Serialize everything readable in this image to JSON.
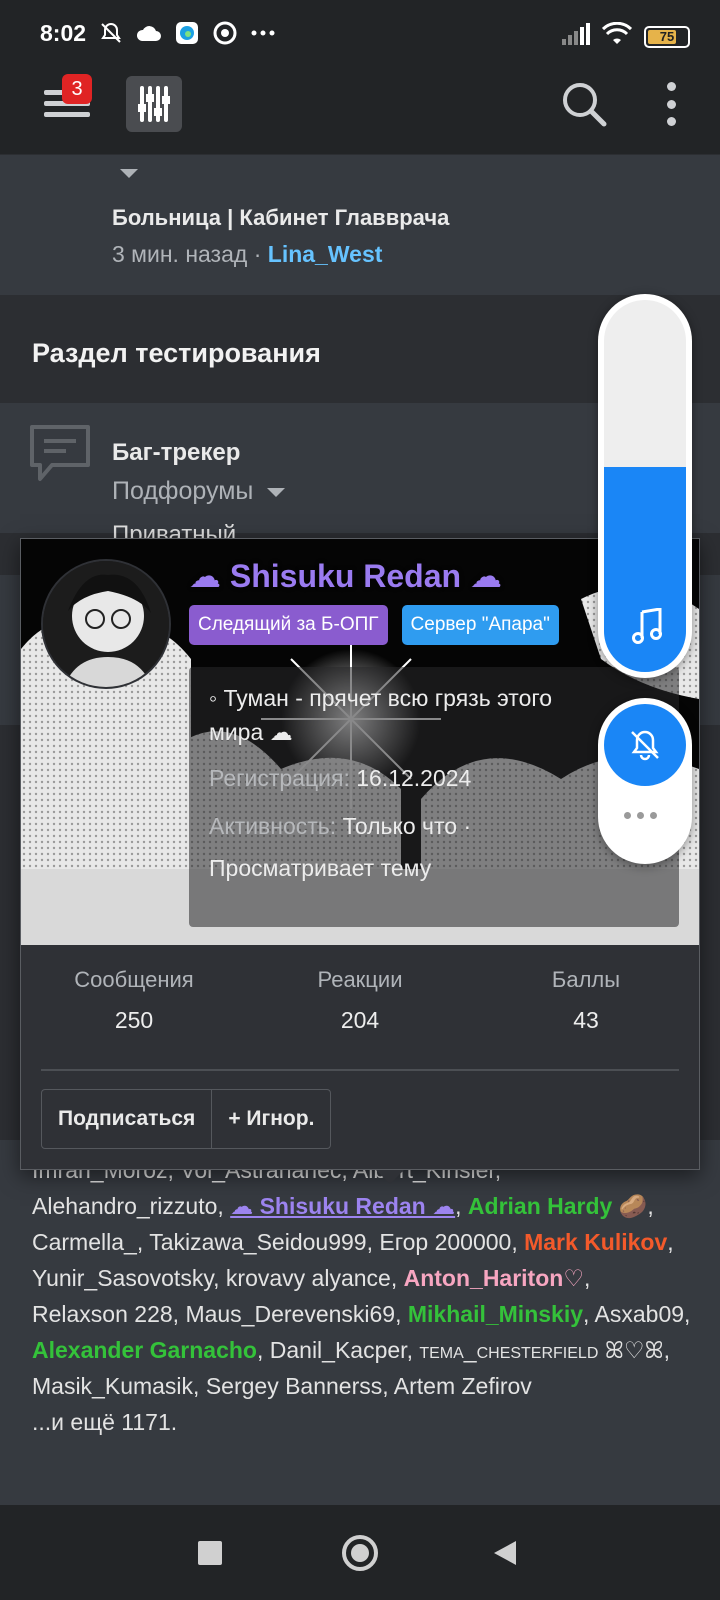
{
  "status_bar": {
    "time": "8:02",
    "battery": "75",
    "icons": [
      "bell-off-icon",
      "cloud-icon",
      "edge-browser-icon",
      "chrome-icon",
      "more-dots-icon"
    ],
    "right_icons": [
      "signal-icon",
      "wifi-icon",
      "battery-icon"
    ]
  },
  "app_bar": {
    "notification_count": "3",
    "icons": [
      "menu-icon",
      "sliders-logo-icon",
      "search-icon",
      "more-vertical-icon"
    ]
  },
  "thread": {
    "title": "Больница | Кабинет Главврача",
    "time": "3 мин. назад",
    "separator": " · ",
    "user": "Lina_West"
  },
  "section": {
    "title": "Раздел тестирования"
  },
  "forum": {
    "title": "Баг-трекер",
    "subforums_label": "Подфорумы",
    "private_label": "Приватный"
  },
  "profile_card": {
    "name": "☁ Shisuku Redan ☁",
    "badges": [
      "Следящий за Б-ОПГ",
      "Сервер \"Апара\""
    ],
    "status_line1": "◦ Туман - прячет всю грязь этого",
    "status_line2": "мира ☁",
    "registration_label": "Регистрация:",
    "registration_value": "16.12.2024",
    "activity_label": "Активность:",
    "activity_value": "Только что ·",
    "activity_detail": "Просматривает тему",
    "stats": [
      {
        "label": "Сообщения",
        "value": "250"
      },
      {
        "label": "Реакции",
        "value": "204"
      },
      {
        "label": "Баллы",
        "value": "43"
      }
    ],
    "follow_button": "Подписаться",
    "ignore_button": "+ Игнор."
  },
  "online": {
    "cut_line": "Imran_Moroz, Vol_Astrahanec, Albert_Kinsler,",
    "u1": "Alehandro_rizzuto",
    "u2": "☁ Shisuku Redan ☁",
    "u3": "Adrian Hardy",
    "u4": "🥔",
    "u5": "Carmella_",
    "u6": "Takizawa_Seidou999",
    "u7": "Егор 200000",
    "u8": "Mark Kulikov",
    "u9": "Yunir_Sasovotsky",
    "u10": "krovavy alyance",
    "u11": "Anton_Hariton♡",
    "u12": "Relaxson 228",
    "u13": "Maus_Derevenski69",
    "u14": "Mikhail_Minskiy",
    "u15": "Asxab09",
    "u16": "Alexander Garnacho",
    "u17": "Danil_Kacper",
    "u18": "тема_chesterfield ꕤ♡ꕤ",
    "u19": "Masik_Kumasik",
    "u20": "Sergey Bannerss",
    "u21": "Artem Zefirov",
    "more": "...и ещё 1171."
  },
  "volume": {
    "level": 0.55,
    "accent": "#1a86f6"
  },
  "colors": {
    "name_purple": "#9a7bf0",
    "user_blue": "#66c3ff",
    "green": "#34c23a",
    "orange": "#f35a2b",
    "pink": "#f7a6c1"
  }
}
